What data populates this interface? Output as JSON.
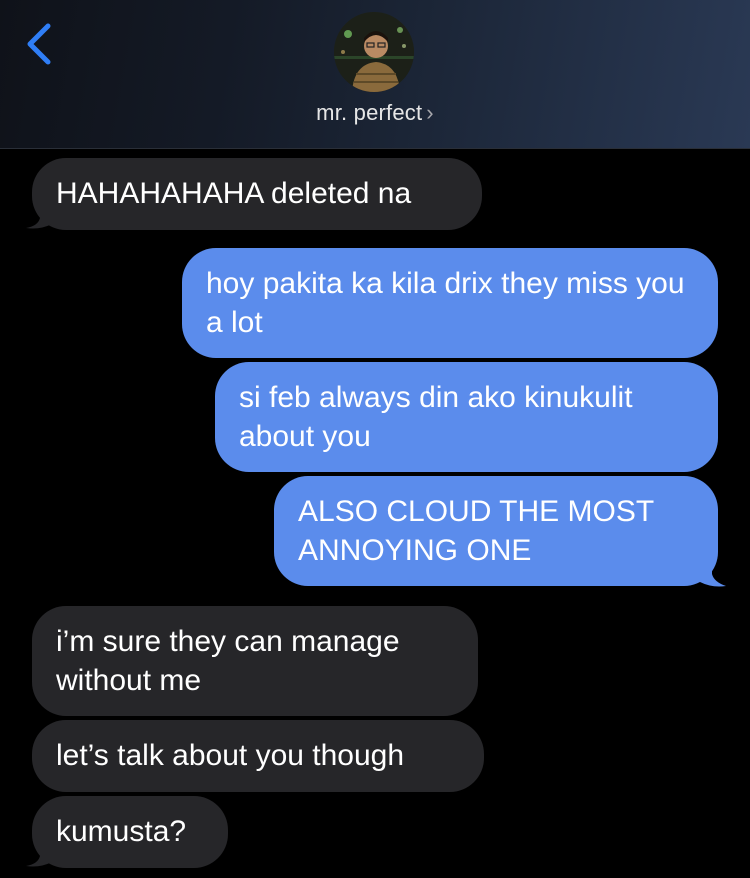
{
  "header": {
    "contact_name": "mr. perfect",
    "chevron": "›",
    "back_icon": "chevron-left-icon",
    "accent": "#2f7ef6"
  },
  "colors": {
    "received_bubble": "#262629",
    "sent_bubble": "#5b8cec",
    "background": "#000000"
  },
  "messages": [
    {
      "from": "contact",
      "text": "HAHAHAHAHA deleted na"
    },
    {
      "from": "me",
      "text": "hoy pakita ka kila drix they miss you a lot"
    },
    {
      "from": "me",
      "text": "si feb always din ako kinukulit about you"
    },
    {
      "from": "me",
      "text": "ALSO CLOUD THE MOST ANNOYING ONE"
    },
    {
      "from": "contact",
      "text": "i’m sure they can manage without me"
    },
    {
      "from": "contact",
      "text": "let’s talk about you though"
    },
    {
      "from": "contact",
      "text": "kumusta?"
    }
  ]
}
